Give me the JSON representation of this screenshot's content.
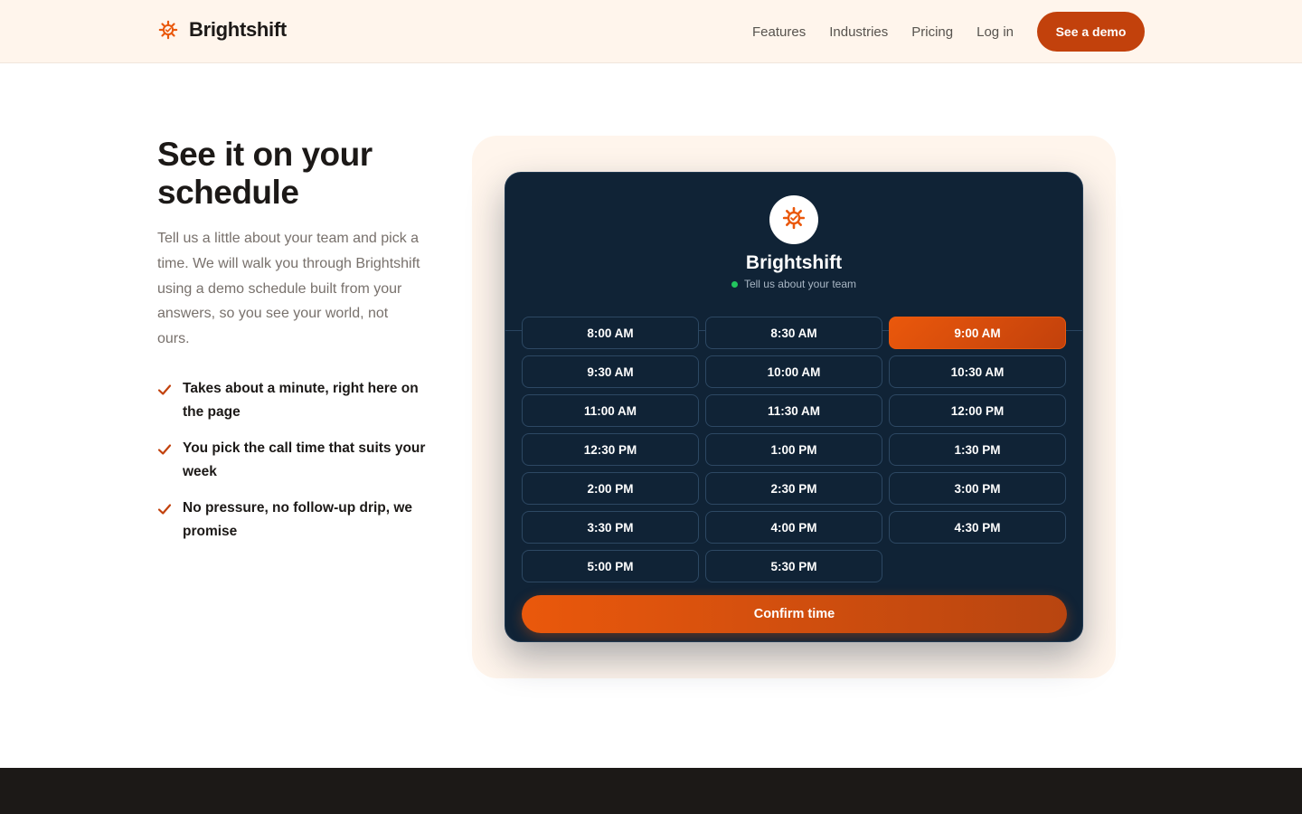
{
  "header": {
    "brand": "Brightshift",
    "nav": [
      "Features",
      "Industries",
      "Pricing",
      "Log in"
    ],
    "cta": "See a demo"
  },
  "hero": {
    "title": "See it on your schedule",
    "description": "Tell us a little about your team and pick a time. We will walk you through Brightshift using a demo schedule built from your answers, so you see your world, not ours.",
    "bullets": [
      "Takes about a minute, right here on the page",
      "You pick the call time that suits your week",
      "No pressure, no follow-up drip, we promise"
    ]
  },
  "widget": {
    "title": "Brightshift",
    "subtitle": "Tell us about your team",
    "slots": [
      "8:00 AM",
      "8:30 AM",
      "9:00 AM",
      "9:30 AM",
      "10:00 AM",
      "10:30 AM",
      "11:00 AM",
      "11:30 AM",
      "12:00 PM",
      "12:30 PM",
      "1:00 PM",
      "1:30 PM",
      "2:00 PM",
      "2:30 PM",
      "3:00 PM",
      "3:30 PM",
      "4:00 PM",
      "4:30 PM",
      "5:00 PM",
      "5:30 PM"
    ],
    "selected_slot": "9:00 AM",
    "confirm": "Confirm time"
  },
  "icons": {
    "brand": "sun-gear-icon",
    "bullet": "check-icon",
    "status": "status-dot-icon"
  },
  "colors": {
    "accent": "#c2410c",
    "accent_bright": "#ea580c",
    "widget_bg": "#102336",
    "header_bg": "#fff5ec",
    "status_dot": "#22c55e",
    "footer": "#1c1917"
  }
}
